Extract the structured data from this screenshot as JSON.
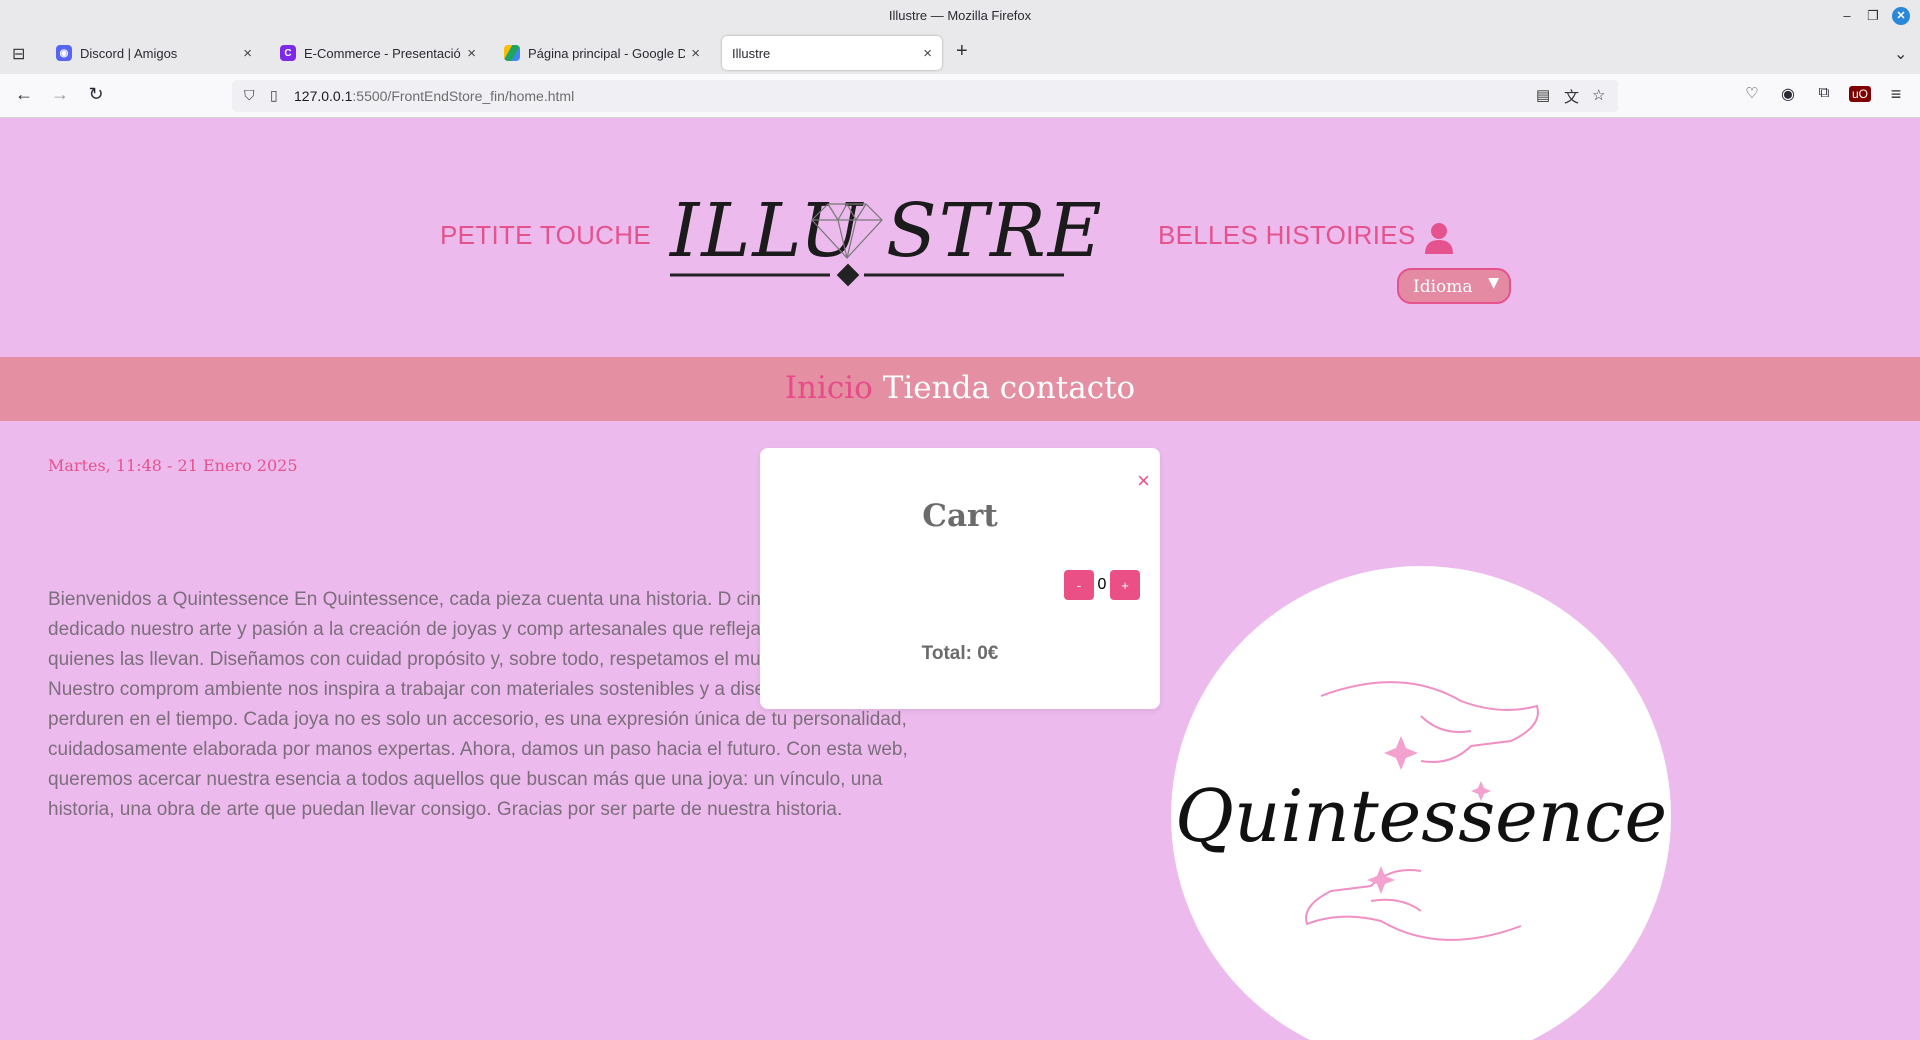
{
  "window": {
    "title": "Illustre — Mozilla Firefox"
  },
  "tabs": [
    {
      "label": "Discord | Amigos",
      "icon": "discord-icon",
      "color": "#5865f2"
    },
    {
      "label": "E-Commerce - Presentación",
      "icon": "canva-icon",
      "color": "#7d2ae8"
    },
    {
      "label": "Página principal - Google Dri",
      "icon": "google-drive-icon",
      "color": "#1fa463"
    },
    {
      "label": "Illustre",
      "icon": "none",
      "color": "",
      "active": true
    }
  ],
  "url": {
    "host": "127.0.0.1",
    "rest": ":5500/FrontEndStore_fin/home.html"
  },
  "header": {
    "left_link": "PETITE TOUCHE",
    "right_link": "BELLES HISTOIRIES",
    "logo_text": "ILLU STRE",
    "language_select": "Idioma"
  },
  "menu": {
    "active": "Inicio",
    "items": [
      "Tienda",
      "contacto"
    ]
  },
  "datetime": "Martes, 11:48 - 21 Enero 2025",
  "intro": "Bienvenidos a Quintessence En Quintessence, cada pieza cuenta una historia. D cinco años, hemos dedicado nuestro arte y pasión a la creación de joyas y comp artesanales que reflejan la esencia de quienes las llevan. Diseñamos con cuidad propósito y, sobre todo, respetamos el mundo que nos rodea. Nuestro comprom ambiente nos inspira a trabajar con materiales sostenibles y a diseñar piezas que perduren en el tiempo. Cada joya no es solo un accesorio, es una expresión única de tu personalidad, cuidadosamente elaborada por manos expertas. Ahora, damos un paso hacia el futuro. Con esta web, queremos acercar nuestra esencia a todos aquellos que buscan más que una joya: un vínculo, una historia, una obra de arte que puedan llevar consigo. Gracias por ser parte de nuestra historia.",
  "brand_image": {
    "text": "Quintessence"
  },
  "cart": {
    "title": "Cart",
    "close": "×",
    "minus": "-",
    "quantity": "0",
    "plus": "+",
    "total": "Total: 0€"
  },
  "colors": {
    "page_bg": "#ecbaec",
    "accent": "#e5538e",
    "menu_bg": "#e48fa2"
  }
}
